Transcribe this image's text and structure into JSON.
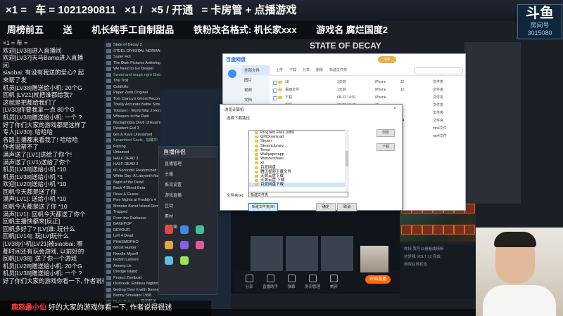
{
  "stream": {
    "top_banner": [
      "×1 =",
      "车 = 1021290811",
      "×1 / ",
      "×5 / 开通",
      "= 卡房管 + 点播游戏"
    ],
    "rank_banner": [
      "周榜前五",
      "送",
      "机长纯手工自制甜品",
      "铁粉改名格式: 机长家xxx",
      "游戏名 腐烂国度2"
    ],
    "platform_logo": "斗鱼",
    "platform_sub": "房间号",
    "room_number": "3015080",
    "game_title": "STATE OF DECAY"
  },
  "chat": [
    {
      "text": "×1 = 车 ="
    },
    {
      "text": "欢迎[LV38]进入直播间"
    },
    {
      "text": "欢迎[LV37]天马Bama进入直播"
    },
    {
      "text": "间"
    },
    {
      "text": "siaobai: 有没有我送的爱心? 起"
    },
    {
      "text": "来帮了发"
    },
    {
      "text": "机员[LV38]赠送给小机: 20个G"
    },
    {
      "text": "回帆 [LV21]就把谁都给我?"
    },
    {
      "text": "这就是把都给我们了"
    },
    {
      "text": "[LV30]你要我拿一点 80个G"
    },
    {
      "text": "机员[LV38]赠送给小机: 一个 ?"
    },
    {
      "text": "好了你们大家的游戏都是这样了"
    },
    {
      "text": "专人[LV30]: 哈哈哈"
    },
    {
      "text": "各路主播都来看我了! 哈哈哈"
    },
    {
      "text": "作者说帮不了"
    },
    {
      "text": "满声送了[LV1]送给了你个!"
    },
    {
      "text": "满声送了(LV1)送给了你个"
    },
    {
      "text": "机员[LV38]送给小机 *10"
    },
    {
      "text": "机员[LV38]送给小机 *1"
    },
    {
      "text": "欢迎[LV20]送给小机 *10"
    },
    {
      "text": "回帆今天都是送了你"
    },
    {
      "text": "满声[LV1]: 送给小机 *10"
    },
    {
      "text": "回帆今天都是送了你 *10"
    },
    {
      "text": "满声[LV1]: 回帆今天都送了你个"
    },
    {
      "text": "回帆主播快都来[反正]"
    },
    {
      "text": "回帆多好了? [LV]谁: 玩什么"
    },
    {
      "text": "回帆[LV14]: 玩[LV]玩什么"
    },
    {
      "text": "[LV38]小机[LV21]被siaobai: 哪"
    },
    {
      "text": "都时间还有玩会游戏, 以前好的"
    },
    {
      "text": "回帆[LV38]: 送了你一个游戏"
    },
    {
      "text": "机员[LV28]赠送给小机: 20个G"
    },
    {
      "text": "机员[LV38]赠送给小机: 一个 ?"
    },
    {
      "text": "好了你们大家的游戏你看一下, 作者说得很迷"
    }
  ],
  "game_list": [
    {
      "name": "State of Decay 2",
      "installed": false
    },
    {
      "name": "STEEL DIVISION: NORMANDY 44",
      "installed": false
    },
    {
      "name": "Super Hot",
      "installed": false
    },
    {
      "name": "The Dark Pictures Anthology: Little",
      "installed": false
    },
    {
      "name": "We Need to Go Deeper",
      "installed": false
    },
    {
      "name": "Sword and magic right Distances",
      "installed": true
    },
    {
      "name": "The Troll",
      "installed": false
    },
    {
      "name": "Coldfollo",
      "installed": false
    },
    {
      "name": "Paper Zeds Original",
      "installed": false
    },
    {
      "name": "Tom Clancy's Ghost Recon Wildlands",
      "installed": false
    },
    {
      "name": "Totally Accurate Battle Simulator",
      "installed": false
    },
    {
      "name": "Totalizer - World War 2 Horror Su",
      "installed": false
    },
    {
      "name": "Whispers in the Dark",
      "installed": false
    },
    {
      "name": "Nyctophobia Devil Unleashed",
      "installed": false
    },
    {
      "name": "Resident Evil 3",
      "installed": false
    },
    {
      "name": "Gin & Keys Unleashed",
      "installed": false
    },
    {
      "name": "Scrambled Souls - 加载中",
      "installed": true
    },
    {
      "name": "Fishing",
      "installed": false
    },
    {
      "name": "Untamed",
      "installed": false
    },
    {
      "name": "HALF DEAD 3",
      "installed": false
    },
    {
      "name": "HALF DEAD 3",
      "installed": false
    },
    {
      "name": "60 Seconds! Reatomized",
      "installed": false
    },
    {
      "name": "White Day: A Labyrinth Named School",
      "installed": false
    },
    {
      "name": "Night of the Dead",
      "installed": false
    },
    {
      "name": "Back 4 Blood Beta",
      "installed": false
    },
    {
      "name": "Draw & Guess",
      "installed": false
    },
    {
      "name": "Five Nights at Freddy's 4",
      "installed": false
    },
    {
      "name": "Monster Kovet Island Demo",
      "installed": false
    },
    {
      "name": "Trapped",
      "installed": false
    },
    {
      "name": "From the Darkness",
      "installed": false
    },
    {
      "name": "BAKEPOP",
      "installed": false
    },
    {
      "name": "DEVOUR",
      "installed": false
    },
    {
      "name": "Left 4 Dead",
      "installed": false
    },
    {
      "name": "PHASMOPHO",
      "installed": false
    },
    {
      "name": "Ghost Hunter",
      "installed": false
    },
    {
      "name": "Needle Myself",
      "installed": false
    },
    {
      "name": "Goblin Lament",
      "installed": false
    },
    {
      "name": "Among Us",
      "installed": false
    },
    {
      "name": "Dredge Island",
      "installed": false
    },
    {
      "name": "Project Zomboid",
      "installed": false
    },
    {
      "name": "Outbreak: Endless Nightmares",
      "installed": false
    },
    {
      "name": "Getting Over It with Bennett Foddy",
      "installed": false
    },
    {
      "name": "Bunny Simulator 1998",
      "installed": false
    },
    {
      "name": "Night Delivery | 夜间配送",
      "installed": false
    }
  ],
  "assistant": {
    "title": "直播伴侣",
    "rows": [
      "直播管理",
      "主播",
      "推流设置",
      "游戏直播",
      "互动",
      "素材",
      "工具箱"
    ]
  },
  "toolbar": [
    "分享",
    "直播助手",
    "弹幕",
    "房间管理",
    "美颜"
  ],
  "go_live": "开始直播",
  "netdisk": {
    "logo": "百度网盘",
    "tabs": [
      "首页",
      "同步",
      "分享",
      "发现",
      "传输"
    ],
    "vip": "VIP",
    "tree": [
      "全部文件",
      "图片",
      "视频",
      "文档",
      "音乐",
      "种子",
      "其他",
      "我的分享",
      "回收站",
      "工具"
    ],
    "tools": [
      "上传",
      "下载",
      "分享",
      "删除",
      "新建文件夹"
    ],
    "rows": [
      {
        "name": "18",
        "date": "1天前",
        "device": "iPhone",
        "size": "12",
        "type": "文件夹"
      },
      {
        "name": "桌面文件",
        "date": "1天前",
        "device": "iPhone",
        "size": "12",
        "type": "文件夹"
      },
      {
        "name": "下载",
        "date": "08-22 14:01",
        "device": "iPhone",
        "size": "",
        "type": "文件夹"
      },
      {
        "name": "视频",
        "date": "08-26 18:45",
        "device": "iPhone",
        "size": "",
        "type": "文件夹"
      },
      {
        "name": "录像",
        "date": "08-26 17:01",
        "device": "iPhone",
        "size": "",
        "type": "文件夹"
      },
      {
        "name": "截图",
        "date": "08-27 16:41",
        "device": "iPhone",
        "size": "24",
        "type": "文件夹"
      },
      {
        "name": "录像2",
        "date": "08-27 21:03",
        "device": "iPhone",
        "size": "",
        "type": "mp4文件"
      },
      {
        "name": "录像3",
        "date": "08-27 21:07",
        "device": "iPhone",
        "size": "",
        "type": "mp4文件"
      }
    ]
  },
  "dialog": {
    "title": "浏览计算机",
    "prompt": "选择下载路径",
    "folders": [
      "Program Files (x86)",
      "QMDownload",
      "Steam",
      "SteamLibrary",
      "Temp",
      "Wallpaperapp",
      "Wondershare",
      "xx",
      "百度网盘",
      "腾讯视频下载文件",
      "天翼云盘下载",
      "天翼云盘 下载",
      "百度网盘下载"
    ],
    "selected_index": 12,
    "side_button_1": "浏览",
    "side_button_2": "下载",
    "folder_label": "文件夹(F):",
    "folder_value": "新建文件夹",
    "new_folder": "新建文件夹(M)",
    "ok": "确定",
    "cancel": "取消"
  },
  "right_lower": [
    "你好,我可以看看成绩嘛",
    "这是我 VOLT 12 完成",
    "游戏在线状态"
  ],
  "bottom_ticker": {
    "left": "鹿怒最小仙",
    "text": "好的大家的游戏你看一下, 作者说得很迷"
  }
}
